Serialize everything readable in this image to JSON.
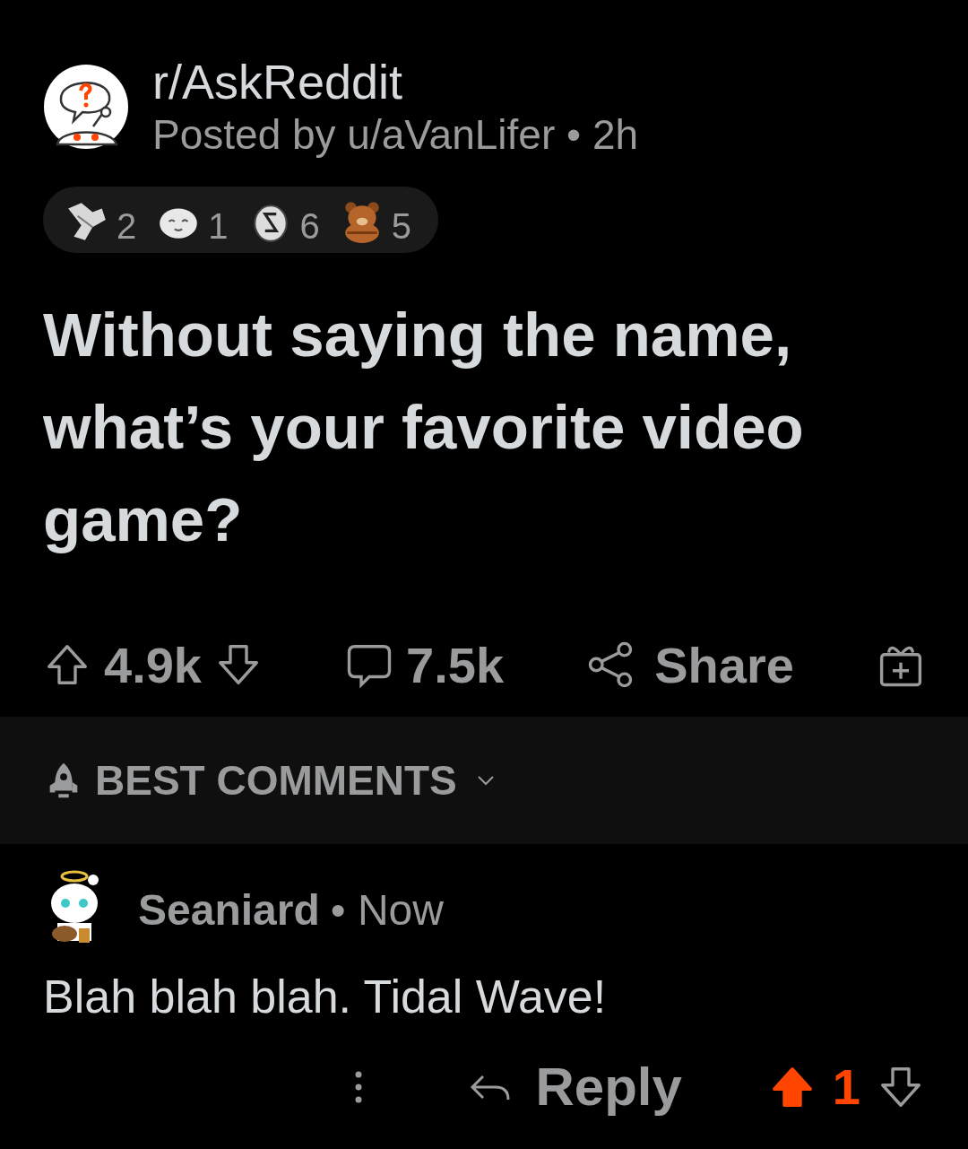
{
  "post": {
    "subreddit": "r/AskReddit",
    "meta": "Posted by u/aVanLifer • 2h",
    "awards": [
      {
        "kind": "armwrestle",
        "count": "2"
      },
      {
        "kind": "seal",
        "count": "1"
      },
      {
        "kind": "coin",
        "count": "6"
      },
      {
        "kind": "bear",
        "count": "5"
      }
    ],
    "title": "Without saying the name, what’s your favorite video game?",
    "votes": "4.9k",
    "upvoted": false,
    "comments": "7.5k",
    "share": "Share"
  },
  "sort": {
    "label": "BEST COMMENTS"
  },
  "comment": {
    "author": "Seaniard",
    "time": "• Now",
    "body": "Blah blah blah. Tidal Wave!",
    "reply": "Reply",
    "votes": "1",
    "upvoted": true
  }
}
